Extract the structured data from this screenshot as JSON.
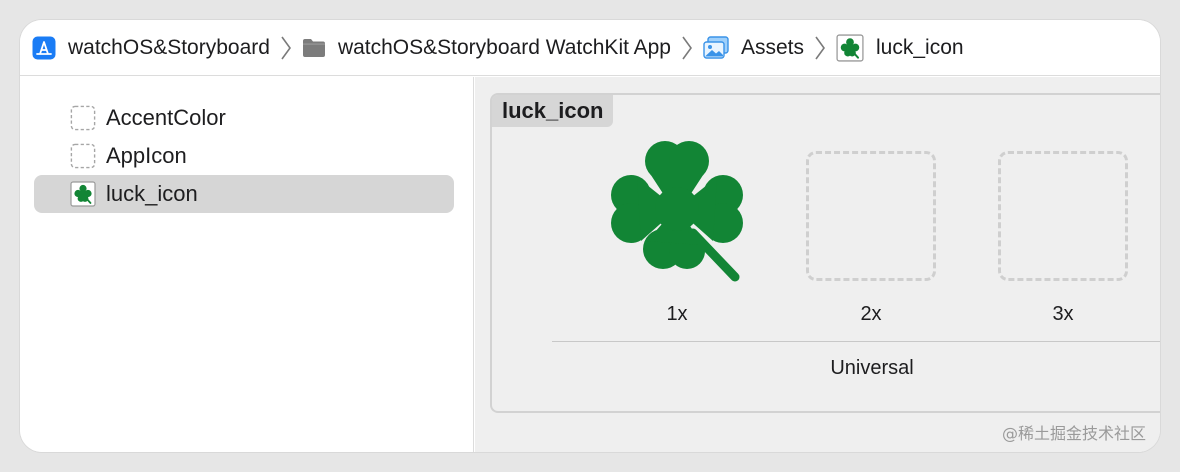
{
  "breadcrumb": {
    "items": [
      {
        "label": "watchOS&Storyboard",
        "icon": "app-store-icon"
      },
      {
        "label": "watchOS&Storyboard WatchKit App",
        "icon": "folder-icon"
      },
      {
        "label": "Assets",
        "icon": "asset-catalog-icon"
      },
      {
        "label": "luck_icon",
        "icon": "clover-image-icon"
      }
    ]
  },
  "sidebar": {
    "items": [
      {
        "label": "AccentColor",
        "icon": "color-set-icon",
        "selected": false
      },
      {
        "label": "AppIcon",
        "icon": "app-icon-set-icon",
        "selected": false
      },
      {
        "label": "luck_icon",
        "icon": "clover-image-icon",
        "selected": true
      }
    ]
  },
  "editor": {
    "set_name": "luck_icon",
    "slots": [
      {
        "label": "1x",
        "filled": true
      },
      {
        "label": "2x",
        "filled": false
      },
      {
        "label": "3x",
        "filled": false
      }
    ],
    "idiom": "Universal"
  },
  "watermark": "@稀土掘金技术社区",
  "colors": {
    "clover": "#128535",
    "selection": "#d6d6d6",
    "accent_blue": "#1a7cf5"
  }
}
